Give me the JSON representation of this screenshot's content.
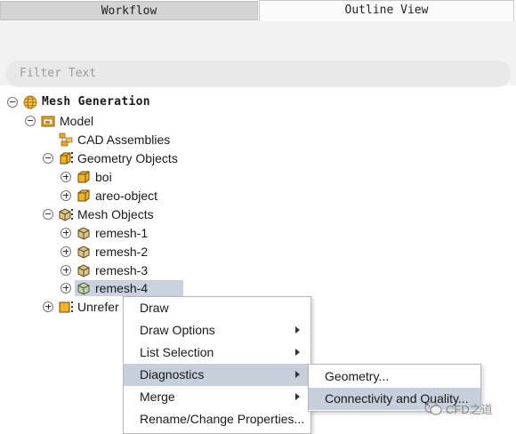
{
  "tabs": {
    "workflow": "Workflow",
    "outline": "Outline View"
  },
  "filter": {
    "placeholder": "Filter Text"
  },
  "tree": {
    "root": "Mesh Generation",
    "model": "Model",
    "cad_assemblies": "CAD Assemblies",
    "geometry_objects": "Geometry Objects",
    "geometry_children": [
      "boi",
      "areo-object"
    ],
    "mesh_objects": "Mesh Objects",
    "mesh_children": [
      "remesh-1",
      "remesh-2",
      "remesh-3",
      "remesh-4"
    ],
    "unreferenced": "Unrefer"
  },
  "context_menu": {
    "items": [
      "Draw",
      "Draw Options",
      "List Selection",
      "Diagnostics",
      "Merge",
      "Rename/Change Properties..."
    ],
    "active": "Diagnostics"
  },
  "submenu": {
    "items": [
      "Geometry...",
      "Connectivity and Quality..."
    ],
    "active": "Connectivity and Quality..."
  },
  "watermark": "CFD之道",
  "colors": {
    "selection": "#c9d3df",
    "menu_highlight": "#c7cfdb",
    "cube": "#f0b429",
    "mesh_cube": "#c9b37a"
  }
}
